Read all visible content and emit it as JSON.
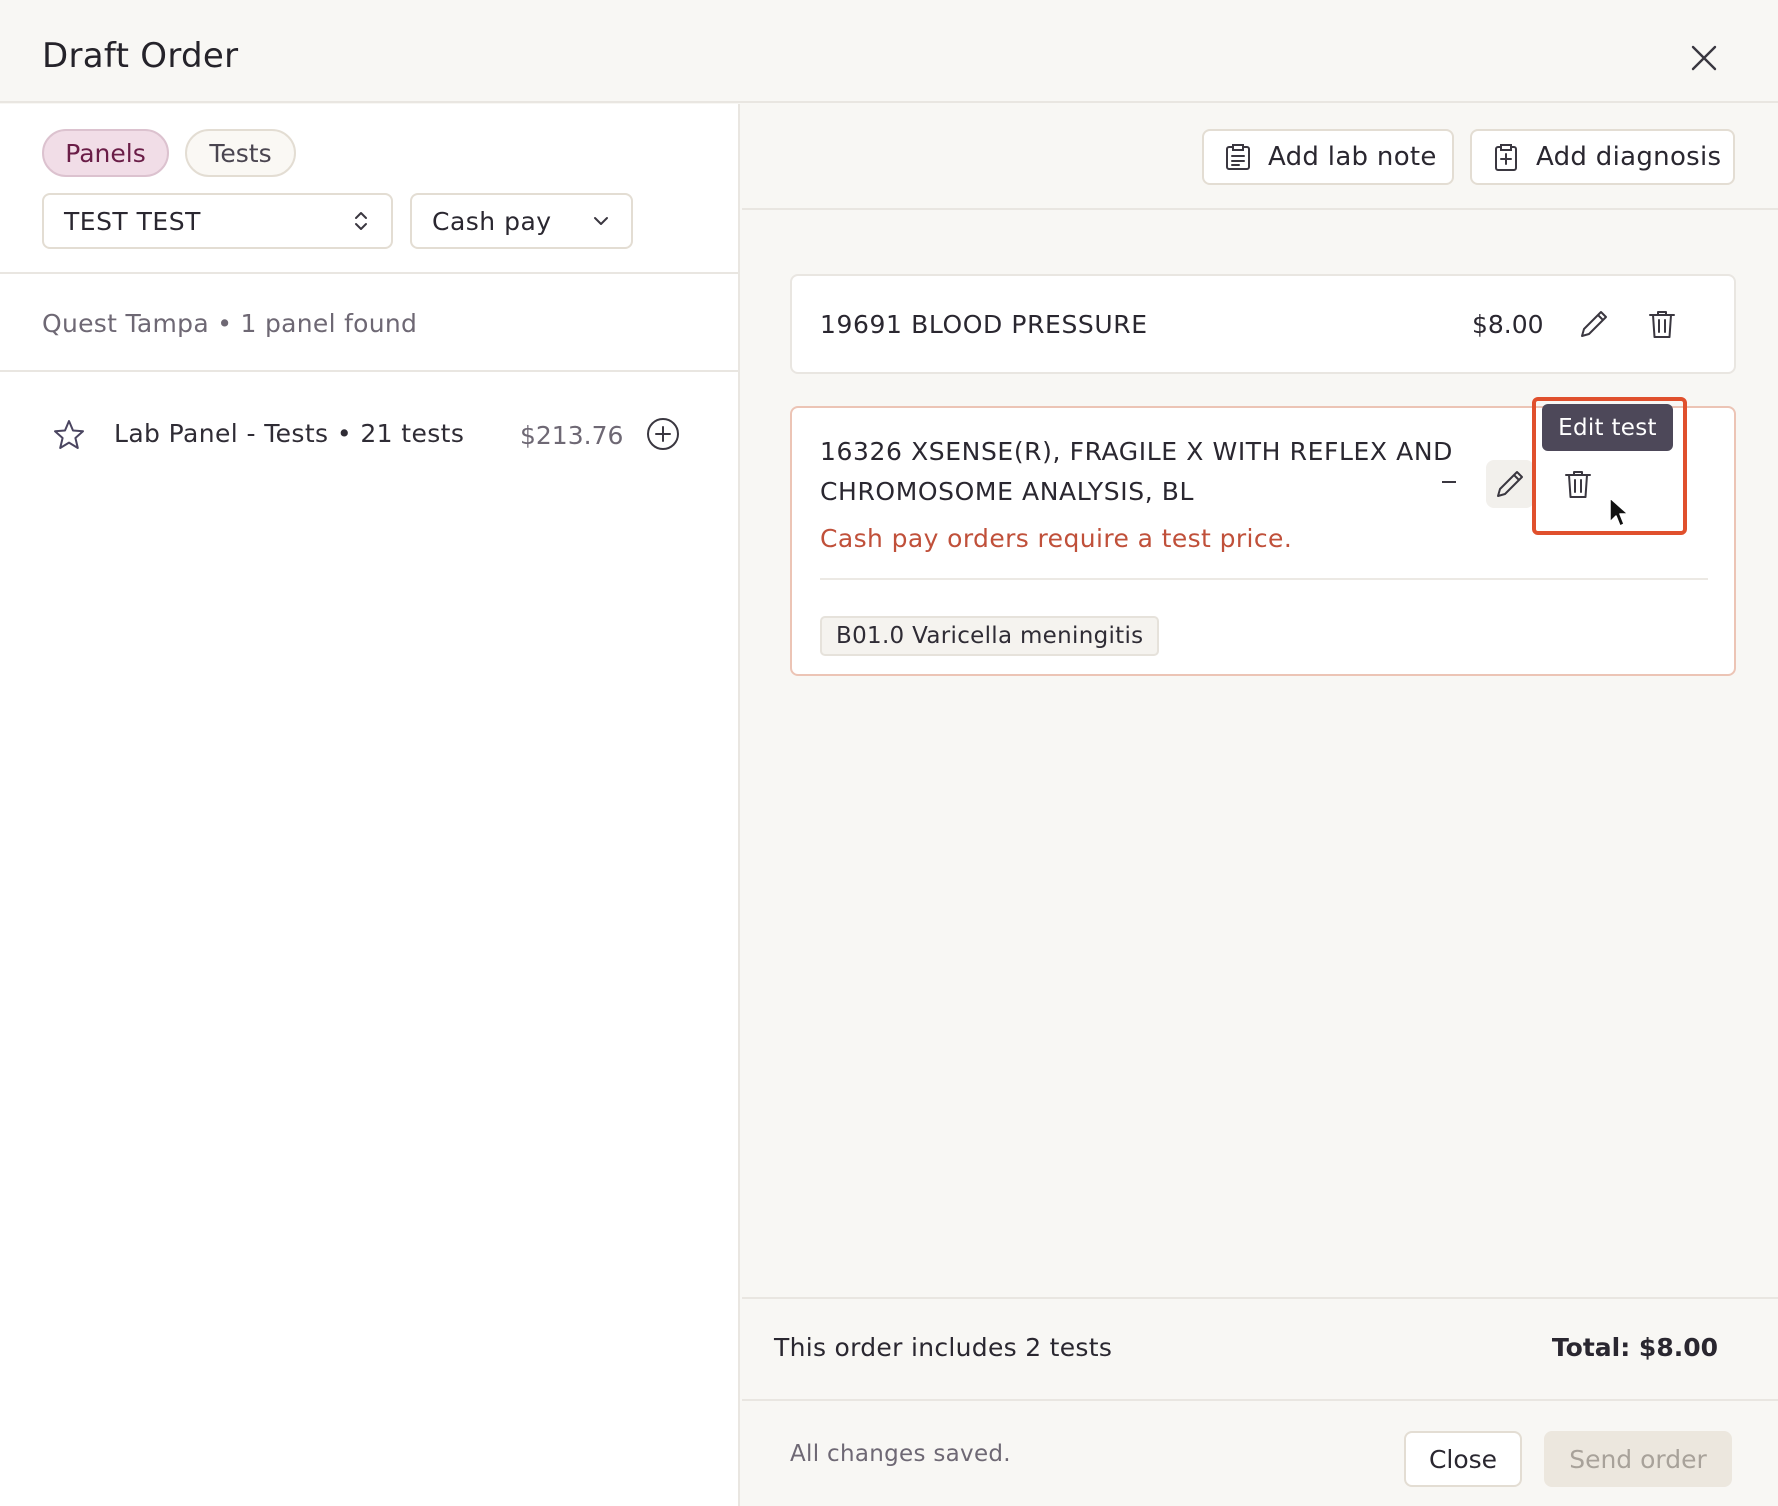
{
  "header": {
    "title": "Draft Order"
  },
  "left": {
    "tabs": [
      {
        "label": "Panels",
        "active": true
      },
      {
        "label": "Tests",
        "active": false
      }
    ],
    "patient_select": {
      "value": "TEST TEST"
    },
    "payer_select": {
      "value": "Cash pay"
    },
    "results_text": "Quest Tampa • 1 panel found",
    "panels": [
      {
        "name": "Lab Panel - Tests • 21 tests",
        "price": "$213.76"
      }
    ]
  },
  "toolbar": {
    "lab_note": "Add lab note",
    "diagnosis": "Add diagnosis"
  },
  "order_items": [
    {
      "name": "19691 BLOOD PRESSURE",
      "price": "$8.00"
    },
    {
      "name": "16326 XSENSE(R), FRAGILE X WITH REFLEX AND CHROMOSOME ANALYSIS, BL",
      "warning": "Cash pay orders require a test price.",
      "diagnosis": "B01.0 Varicella meningitis"
    }
  ],
  "tooltip": "Edit test",
  "summary": {
    "count_text": "This order includes 2 tests",
    "total_text": "Total: $8.00"
  },
  "footer": {
    "status": "All changes saved.",
    "close_label": "Close",
    "send_label": "Send order"
  },
  "colors": {
    "accent_pill_bg": "#f1dde7",
    "warning": "#c0503a",
    "tooltip_bg": "#4d4859",
    "highlight": "#e0502d"
  },
  "icons": [
    "close-icon",
    "chevron-updown-icon",
    "chevron-down-icon",
    "star-icon",
    "plus-circle-icon",
    "clipboard-note-icon",
    "clipboard-medical-icon",
    "pencil-icon",
    "trash-icon",
    "cursor-icon"
  ]
}
